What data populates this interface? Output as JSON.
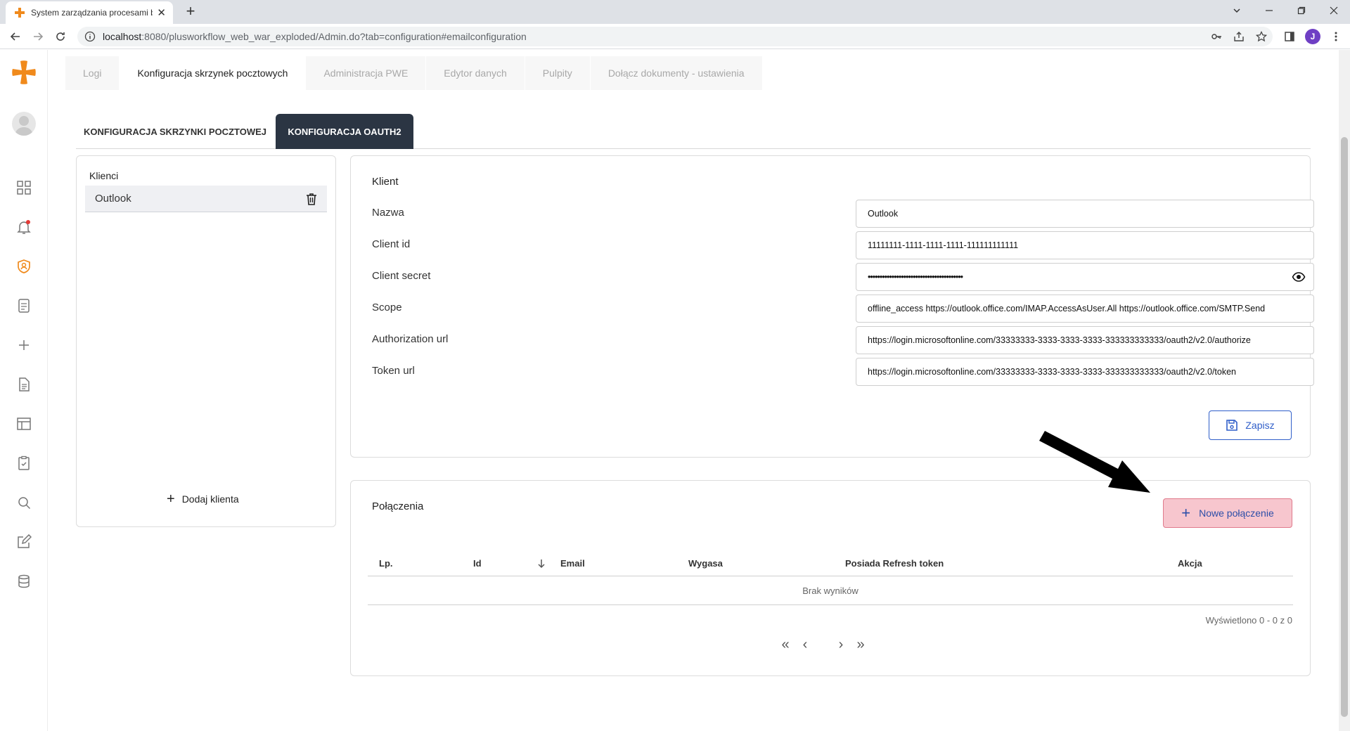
{
  "browser": {
    "tab_title": "System zarządzania procesami bi",
    "url_host": "localhost",
    "url_rest": ":8080/plusworkflow_web_war_exploded/Admin.do?tab=configuration#emailconfiguration",
    "profile_initial": "J"
  },
  "top_tabs": [
    {
      "label": "Logi"
    },
    {
      "label": "Konfiguracja skrzynek pocztowych"
    },
    {
      "label": "Administracja PWE"
    },
    {
      "label": "Edytor danych"
    },
    {
      "label": "Pulpity"
    },
    {
      "label": "Dołącz dokumenty - ustawienia"
    }
  ],
  "sub_tabs": [
    {
      "label": "Konfiguracja skrzynki pocztowej"
    },
    {
      "label": "Konfiguracja OAUTH2"
    }
  ],
  "clients": {
    "header": "Klienci",
    "items": [
      {
        "label": "Outlook"
      }
    ],
    "add_label": "Dodaj klienta"
  },
  "client_form": {
    "title": "Klient",
    "fields": [
      {
        "label": "Nazwa",
        "value": "Outlook"
      },
      {
        "label": "Client id",
        "value": "11111111-1111-1111-1111-111111111111"
      },
      {
        "label": "Client secret",
        "value": "••••••••••••••••••••••••••••••••••••••••"
      },
      {
        "label": "Scope",
        "value": "offline_access https://outlook.office.com/IMAP.AccessAsUser.All https://outlook.office.com/SMTP.Send"
      },
      {
        "label": "Authorization url",
        "value": "https://login.microsoftonline.com/33333333-3333-3333-3333-333333333333/oauth2/v2.0/authorize"
      },
      {
        "label": "Token url",
        "value": "https://login.microsoftonline.com/33333333-3333-3333-3333-333333333333/oauth2/v2.0/token"
      }
    ],
    "save_label": "Zapisz"
  },
  "connections": {
    "title": "Połączenia",
    "new_label": "Nowe połączenie",
    "columns": [
      "Lp.",
      "Id",
      "Email",
      "Wygasa",
      "Posiada Refresh token",
      "Akcja"
    ],
    "empty_text": "Brak wyników",
    "count_text": "Wyświetlono 0 - 0 z 0",
    "pager": {
      "first": "«",
      "prev": "‹",
      "next": "›",
      "last": "»"
    }
  },
  "colors": {
    "accent_orange": "#f08a1c",
    "active_subtab": "#2b3543",
    "primary_blue": "#2f5ec9",
    "new_conn_bg": "#f7c6ce"
  }
}
